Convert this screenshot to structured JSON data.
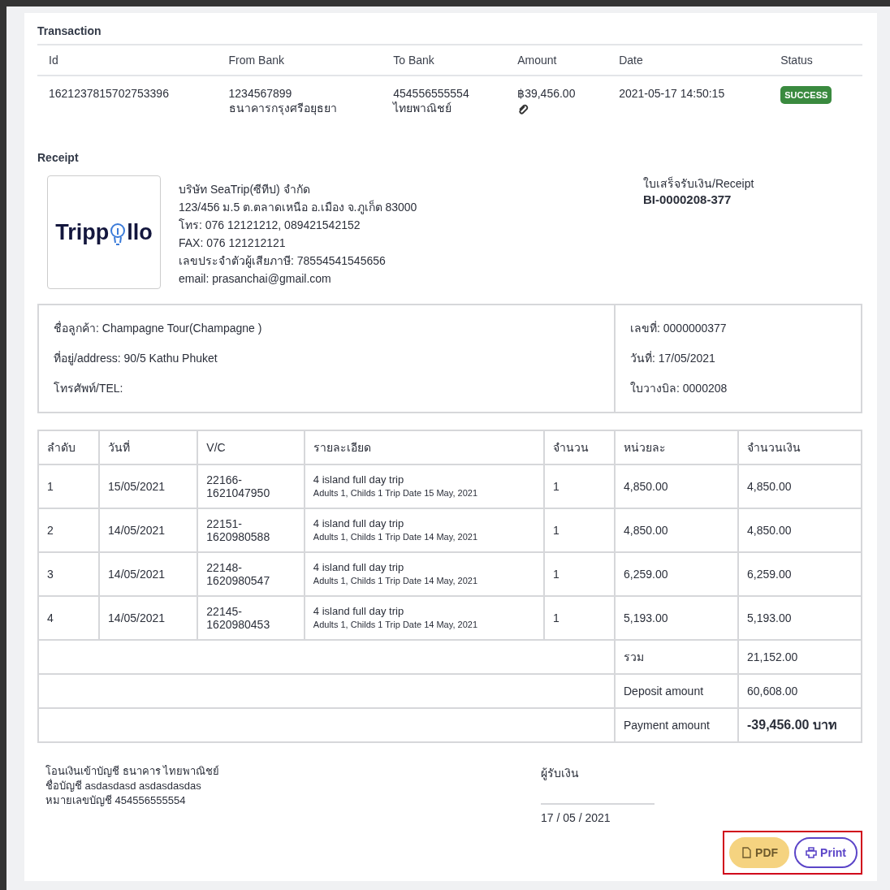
{
  "transaction": {
    "title": "Transaction",
    "columns": [
      "Id",
      "From Bank",
      "To Bank",
      "Amount",
      "Date",
      "Status"
    ],
    "rows": [
      {
        "id": "1621237815702753396",
        "from_account": "1234567899",
        "from_bank": "ธนาคารกรุงศรีอยุธยา",
        "to_account": "454556555554",
        "to_bank": "ไทยพาณิชย์",
        "amount": "฿39,456.00",
        "attachment": true,
        "date": "2021-05-17 14:50:15",
        "status": "SUCCESS",
        "color": "#3a8a3f"
      }
    ]
  },
  "receipt": {
    "title": "Receipt",
    "logo": {
      "before": "Tripp",
      "after": "llo"
    },
    "company_lines": [
      "บริษัท SeaTrip(ซีทีป) จำกัด",
      "123/456 ม.5 ต.ตลาดเหนือ อ.เมือง จ.ภูเก็ต 83000",
      "โทร: 076 12121212, 089421542152",
      "FAX: 076 121212121",
      "เลขประจำตัวผู้เสียภาษี: 78554541545656",
      "email: prasanchai@gmail.com"
    ],
    "doc_label": "ใบเสร็จรับเงิน/Receipt",
    "doc_number": "BI-0000208-377",
    "customer": [
      "ชื่อลูกค้า: Champagne Tour(Champagne )",
      "ที่อยู่/address: 90/5 Kathu Phuket",
      "โทรศัพท์/TEL:"
    ],
    "doc_info": [
      "เลขที่: 0000000377",
      "วันที่: 17/05/2021",
      "ใบวางบิล: 0000208"
    ]
  },
  "items": {
    "columns": [
      "ลำดับ",
      "วันที่",
      "V/C",
      "รายละเอียด",
      "จำนวน",
      "หน่วยละ",
      "จำนวนเงิน"
    ],
    "rows": [
      {
        "no": "1",
        "date": "15/05/2021",
        "vc": "22166-\n1621047950",
        "title": "4 island full day trip",
        "detail": "Adults 1, Childs 1  Trip Date 15 May, 2021",
        "qty": "1",
        "unit": "4,850.00",
        "total": "4,850.00"
      },
      {
        "no": "2",
        "date": "14/05/2021",
        "vc": "22151-\n1620980588",
        "title": "4 island full day trip",
        "detail": "Adults 1, Childs 1  Trip Date 14 May, 2021",
        "qty": "1",
        "unit": "4,850.00",
        "total": "4,850.00"
      },
      {
        "no": "3",
        "date": "14/05/2021",
        "vc": "22148-\n1620980547",
        "title": "4 island full day trip",
        "detail": "Adults 1, Childs 1  Trip Date 14 May, 2021",
        "qty": "1",
        "unit": "6,259.00",
        "total": "6,259.00"
      },
      {
        "no": "4",
        "date": "14/05/2021",
        "vc": "22145-\n1620980453",
        "title": "4 island full day trip",
        "detail": "Adults 1, Childs 1  Trip Date 14 May, 2021",
        "qty": "1",
        "unit": "5,193.00",
        "total": "5,193.00"
      }
    ],
    "totals": [
      {
        "label": "รวม",
        "value": "21,152.00",
        "emphasis": false
      },
      {
        "label": "Deposit amount",
        "value": "60,608.00",
        "emphasis": false
      },
      {
        "label": "Payment amount",
        "value": "-39,456.00 บาท",
        "emphasis": true
      }
    ]
  },
  "footer": {
    "bank_lines": [
      "โอนเงินเข้าบัญชี ธนาคาร ไทยพาณิชย์",
      "ชื่อบัญชี asdasdasd asdasdasdas",
      "หมายเลขบัญชี 454556555554"
    ],
    "payee_label": "ผู้รับเงิน",
    "payee_date": "17 / 05 / 2021"
  },
  "actions": [
    {
      "kind": "pdf",
      "label": "PDF"
    },
    {
      "kind": "print",
      "label": "Print"
    }
  ]
}
